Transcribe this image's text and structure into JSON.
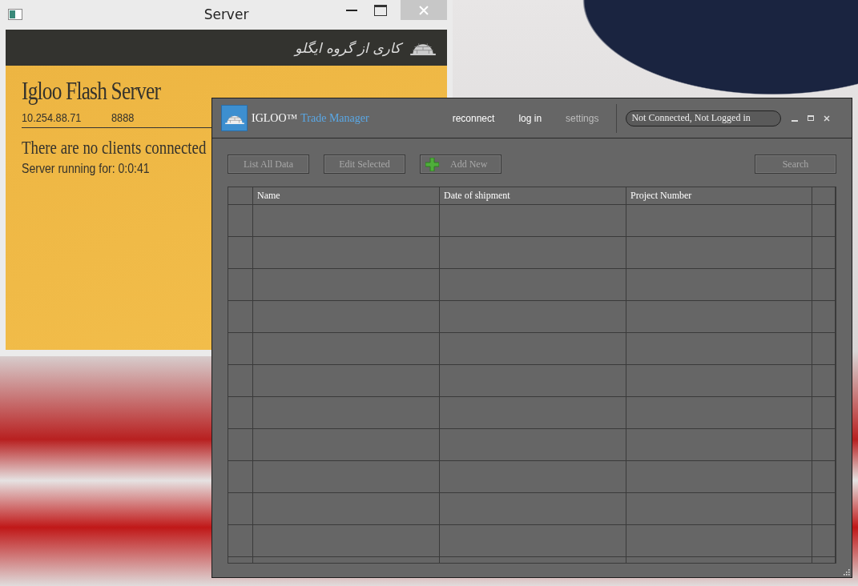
{
  "server_window": {
    "title": "Server",
    "banner_text": "کاری از گروه ایگلو",
    "heading": "Igloo Flash Server",
    "ip_address": "10.254.88.71",
    "port": "8888",
    "clients_message": "There are no clients connected",
    "uptime": "Server running for: 0:0:41"
  },
  "trade_window": {
    "brand": "IGLOO™",
    "title": "Trade Manager",
    "nav": [
      {
        "label": "reconnect",
        "disabled": false
      },
      {
        "label": "log in",
        "disabled": false
      },
      {
        "label": "settings",
        "disabled": true
      }
    ],
    "status": "Not Connected, Not Logged in",
    "toolbar": [
      {
        "label": "List All Data",
        "kind": "plain",
        "disabled": true
      },
      {
        "label": "Edit Selected",
        "kind": "plain",
        "disabled": true
      },
      {
        "label": "Add New",
        "kind": "add",
        "disabled": true
      }
    ],
    "search_button": {
      "label": "Search",
      "disabled": true
    },
    "table": {
      "columns": [
        "",
        "Name",
        "Date of shipment",
        "Project Number",
        ""
      ]
    }
  }
}
